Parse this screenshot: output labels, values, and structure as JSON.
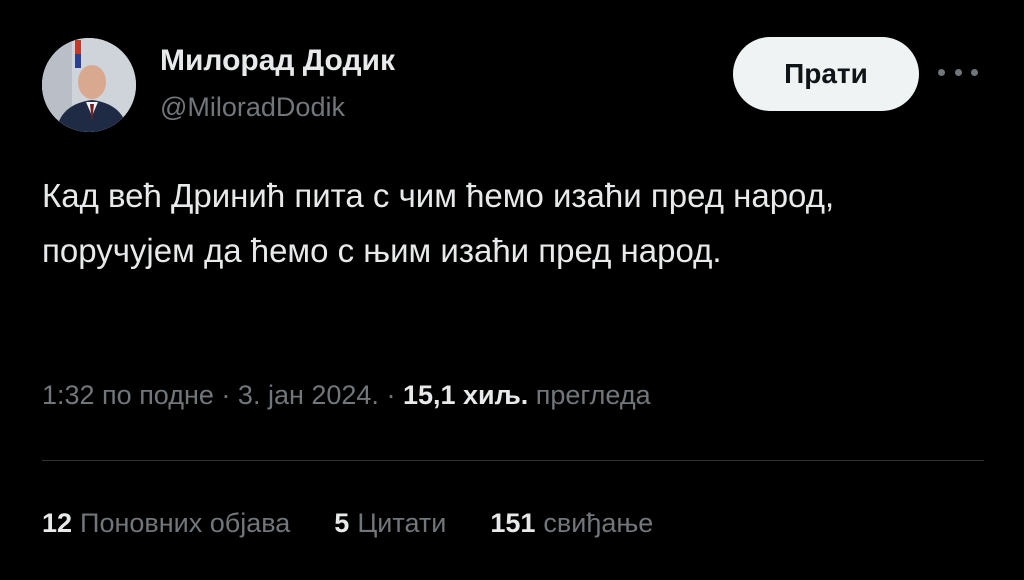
{
  "author": {
    "display_name": "Милорад Додик",
    "handle": "@MiloradDodik",
    "avatar_icon": "profile-photo"
  },
  "follow_button": {
    "label": "Прати"
  },
  "more_icon": "more-horizontal-icon",
  "tweet": {
    "text": "Кад већ Дринић пита с чим ћемо изаћи пред народ, поручујем да ћемо с њим изаћи пред народ."
  },
  "meta": {
    "time": "1:32 по подне",
    "separator1": " · ",
    "date": "3. јан 2024.",
    "separator2": " · ",
    "views_count": "15,1 хиљ.",
    "views_label": " прегледа"
  },
  "stats": {
    "reposts": {
      "count": "12",
      "label": "Поновних објава"
    },
    "quotes": {
      "count": "5",
      "label": "Цитати"
    },
    "likes": {
      "count": "151",
      "label": "свиђање"
    }
  },
  "colors": {
    "background": "#000000",
    "primary_text": "#e7e9ea",
    "secondary_text": "#71767b",
    "divider": "#2f3336",
    "button_bg": "#eff3f4"
  }
}
